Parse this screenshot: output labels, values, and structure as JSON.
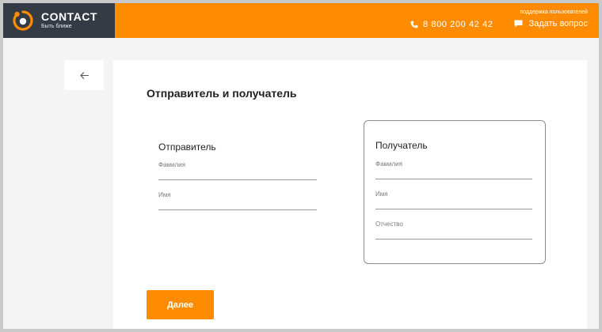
{
  "brand": {
    "name": "CONTACT",
    "tagline": "Быть ближе",
    "logo_icon": "contact-logo-icon",
    "colors": {
      "accent": "#ff8c00",
      "header_dark": "#353b45"
    }
  },
  "header": {
    "support_label": "поддержка пользователей",
    "phone": "8 800 200 42 42",
    "phone_icon": "phone-icon",
    "ask_label": "Задать вопрос",
    "ask_icon": "chat-icon"
  },
  "back_button": {
    "icon": "arrow-left-icon"
  },
  "form": {
    "title": "Отправитель и получатель",
    "sender": {
      "title": "Отправитель",
      "fields": [
        {
          "label": "Фамилия",
          "value": ""
        },
        {
          "label": "Имя",
          "value": ""
        }
      ]
    },
    "recipient": {
      "title": "Получатель",
      "fields": [
        {
          "label": "Фамилия",
          "value": ""
        },
        {
          "label": "Имя",
          "value": ""
        },
        {
          "label": "Отчество",
          "value": ""
        }
      ]
    },
    "next_label": "Далее"
  }
}
